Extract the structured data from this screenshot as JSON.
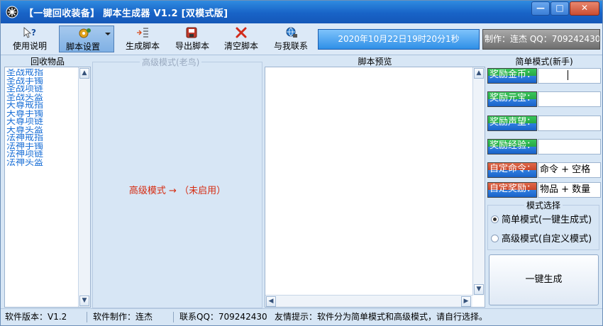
{
  "window": {
    "title": "【一键回收装备】 脚本生成器 V1.2 [双模式版]",
    "controls": {
      "minimize": "—",
      "maximize": "□",
      "close": "✕"
    }
  },
  "toolbar": {
    "buttons": [
      {
        "label": "使用说明",
        "icon": "help-icon"
      },
      {
        "label": "脚本设置",
        "icon": "settings-icon"
      },
      {
        "label": "生成脚本",
        "icon": "generate-icon"
      },
      {
        "label": "导出脚本",
        "icon": "export-icon"
      },
      {
        "label": "清空脚本",
        "icon": "clear-icon"
      },
      {
        "label": "与我联系",
        "icon": "contact-icon"
      }
    ],
    "datetime": "2020年10月22日19时20分1秒",
    "author": "制作：连杰  QQ：709242430"
  },
  "recycle": {
    "header": "回收物品",
    "items": [
      "圣战戒指",
      "圣战手镯",
      "圣战项链",
      "圣战头盔",
      "天尊戒指",
      "天尊手镯",
      "天尊项链",
      "天尊头盔",
      "法神戒指",
      "法神手镯",
      "法神项链",
      "法神头盔"
    ]
  },
  "advanced": {
    "title": "高级模式(老鸟)",
    "message": "高级模式 → （未启用）"
  },
  "preview": {
    "header": "脚本预览"
  },
  "simple": {
    "header": "简单模式(新手)",
    "fields": [
      {
        "label": "奖励金币：",
        "value": ""
      },
      {
        "label": "奖励元宝：",
        "value": ""
      },
      {
        "label": "奖励声望：",
        "value": ""
      },
      {
        "label": "奖励经验：",
        "value": ""
      },
      {
        "label": "自定命令：",
        "value": "命令 + 空格"
      },
      {
        "label": "自定奖励：",
        "value": "物品 + 数量"
      }
    ]
  },
  "mode": {
    "title": "模式选择",
    "options": [
      {
        "label": "简单模式(一键生成式)",
        "selected": true
      },
      {
        "label": "高级模式(自定义模式)",
        "selected": false
      }
    ],
    "generate_label": "一键生成"
  },
  "status": {
    "version": "软件版本：V1.2",
    "author": "软件制作：连杰",
    "qq": "联系QQ：709242430",
    "tip": "友情提示：软件分为简单模式和高级模式，请自行选择。"
  }
}
